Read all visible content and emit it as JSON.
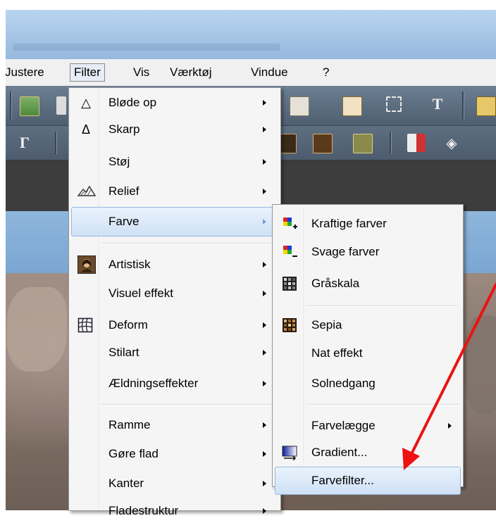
{
  "menubar": {
    "items": [
      "Justere",
      "Filter",
      "Vis",
      "Værktøj",
      "Vindue",
      "?"
    ],
    "active": "Filter"
  },
  "filter_menu": {
    "items": [
      {
        "label": "Bløde op",
        "icon": "drop-outline-icon",
        "submenu": true
      },
      {
        "label": "Skarp",
        "icon": "triangle-outline-icon",
        "submenu": true
      },
      {
        "label": "Støj",
        "icon": "",
        "submenu": true
      },
      {
        "label": "Relief",
        "icon": "relief-icon",
        "submenu": true
      },
      {
        "label": "Farve",
        "icon": "",
        "submenu": true,
        "highlighted": true
      },
      {
        "label": "Artistisk",
        "icon": "portrait-icon",
        "submenu": true
      },
      {
        "label": "Visuel effekt",
        "icon": "",
        "submenu": true
      },
      {
        "label": "Deform",
        "icon": "grid-warp-icon",
        "submenu": true
      },
      {
        "label": "Stilart",
        "icon": "",
        "submenu": true
      },
      {
        "label": "Ældningseffekter",
        "icon": "",
        "submenu": true
      },
      {
        "label": "Ramme",
        "icon": "",
        "submenu": true
      },
      {
        "label": "Gøre flad",
        "icon": "",
        "submenu": true
      },
      {
        "label": "Kanter",
        "icon": "",
        "submenu": true
      },
      {
        "label": "Fladestruktur",
        "icon": "",
        "submenu": true
      }
    ]
  },
  "farve_submenu": {
    "items": [
      {
        "label": "Kraftige farver",
        "icon": "color-plus-icon"
      },
      {
        "label": "Svage farver",
        "icon": "color-minus-icon"
      },
      {
        "label": "Gråskala",
        "icon": "grayscale-grid-icon"
      },
      {
        "label": "Sepia",
        "icon": "sepia-grid-icon"
      },
      {
        "label": "Nat effekt",
        "icon": ""
      },
      {
        "label": "Solnedgang",
        "icon": ""
      },
      {
        "label": "Farvelægge",
        "icon": "",
        "submenu": true
      },
      {
        "label": "Gradient...",
        "icon": "gradient-icon"
      },
      {
        "label": "Farvefilter...",
        "icon": "",
        "highlighted": true
      }
    ]
  },
  "annotation": {
    "color": "#ee1111",
    "type": "arrow",
    "points_to": "Farvefilter..."
  }
}
